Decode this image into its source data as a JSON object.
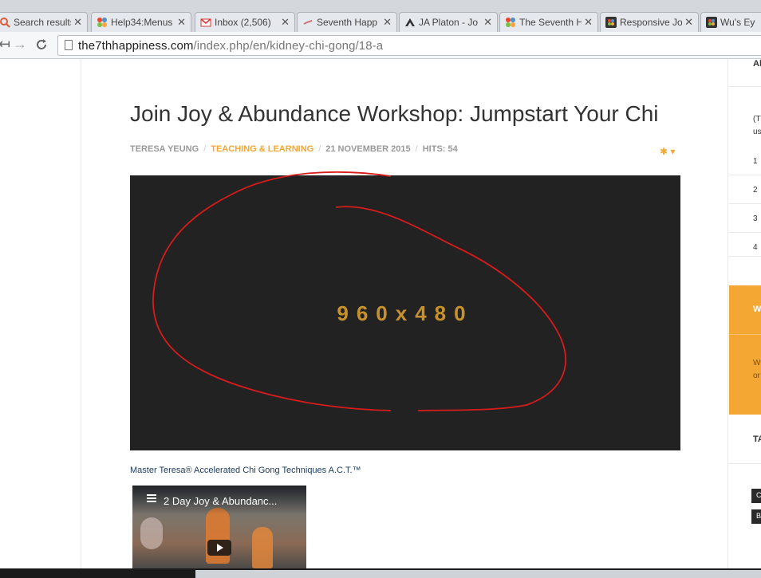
{
  "browser": {
    "tabs": [
      {
        "title": "Search results",
        "icon": "search-favicon"
      },
      {
        "title": "Help34:Menus",
        "icon": "joomla-favicon"
      },
      {
        "title": "Inbox (2,506)",
        "icon": "gmail-favicon"
      },
      {
        "title": "Seventh Happ",
        "icon": "link-favicon"
      },
      {
        "title": "JA Platon - Jo",
        "icon": "ja-favicon"
      },
      {
        "title": "The Seventh H",
        "icon": "joomla-favicon"
      },
      {
        "title": "Responsive Jo",
        "icon": "joomla-dark-favicon"
      },
      {
        "title": "Wu's Eye",
        "icon": "joomla-dark-favicon"
      }
    ],
    "url_domain": "the7thhappiness.com",
    "url_path": "/index.php/en/kidney-chi-gong/18-a"
  },
  "article": {
    "title": "Join Joy & Abundance Workshop: Jumpstart Your Chi",
    "author": "TERESA YEUNG",
    "category": "TEACHING & LEARNING",
    "date": "21 NOVEMBER 2015",
    "hits": "HITS: 54",
    "image_placeholder": "960x480",
    "caption": "Master Teresa® Accelerated Chi Gong Techniques A.C.T.™",
    "video_title": "2 Day Joy & Abundanc..."
  },
  "sidebar": {
    "heading_fragment": "Al",
    "intro_fragment_1": "(T",
    "intro_fragment_2": "us",
    "list_numbers": [
      "1",
      "2",
      "3",
      "4"
    ],
    "orange_heading_fragment": "W",
    "orange_text_1": "W",
    "orange_text_2": "or",
    "tags_heading_fragment": "TA",
    "tag_fragments": [
      "C",
      "B"
    ]
  },
  "colors": {
    "accent": "#f4a733",
    "hero_bg": "#222222",
    "placeholder_text": "#c8922a",
    "annotation": "#d81b1b"
  }
}
